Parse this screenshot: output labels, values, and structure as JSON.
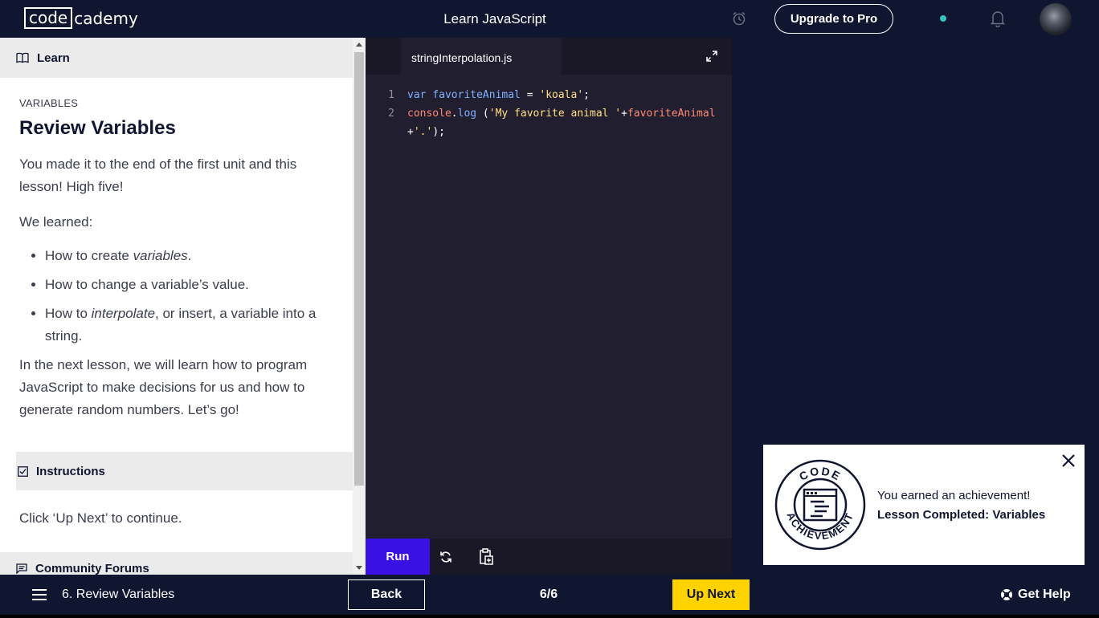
{
  "topbar": {
    "logo_box": "code",
    "logo_rest": "cademy",
    "course_title": "Learn JavaScript",
    "upgrade_label": "Upgrade to Pro",
    "status_color": "#37c3be"
  },
  "left": {
    "learn_tab": "Learn",
    "kicker": "VARIABLES",
    "title": "Review Variables",
    "p1": "You made it to the end of the first unit and this lesson! High five!",
    "p2": "We learned:",
    "bullets": {
      "b1_pre": "How to create ",
      "b1_em": "variables",
      "b1_post": ".",
      "b2": "How to change a variable’s value.",
      "b3_pre": "How to ",
      "b3_em": "interpolate",
      "b3_post": ", or insert, a variable into a string."
    },
    "p3": "In the next lesson, we will learn how to program JavaScript to make decisions for us and how to generate random numbers. Let’s go!",
    "instructions_label": "Instructions",
    "instructions_text": "Click ‘Up Next’ to continue.",
    "community_label": "Community Forums"
  },
  "editor": {
    "tab_name": "stringInterpolation.js",
    "line_numbers": [
      "1",
      "2"
    ],
    "run_label": "Run"
  },
  "achievement": {
    "line1": "You earned an achievement!",
    "line2": "Lesson Completed: Variables",
    "badge_top": "CODE",
    "badge_bottom": "ACHIEVEMENT"
  },
  "bottombar": {
    "lesson_name": "6. Review Variables",
    "back_label": "Back",
    "progress": "6/6",
    "next_label": "Up Next",
    "help_label": "Get Help",
    "next_color": "#ffd300",
    "run_color": "#3a10e5"
  }
}
